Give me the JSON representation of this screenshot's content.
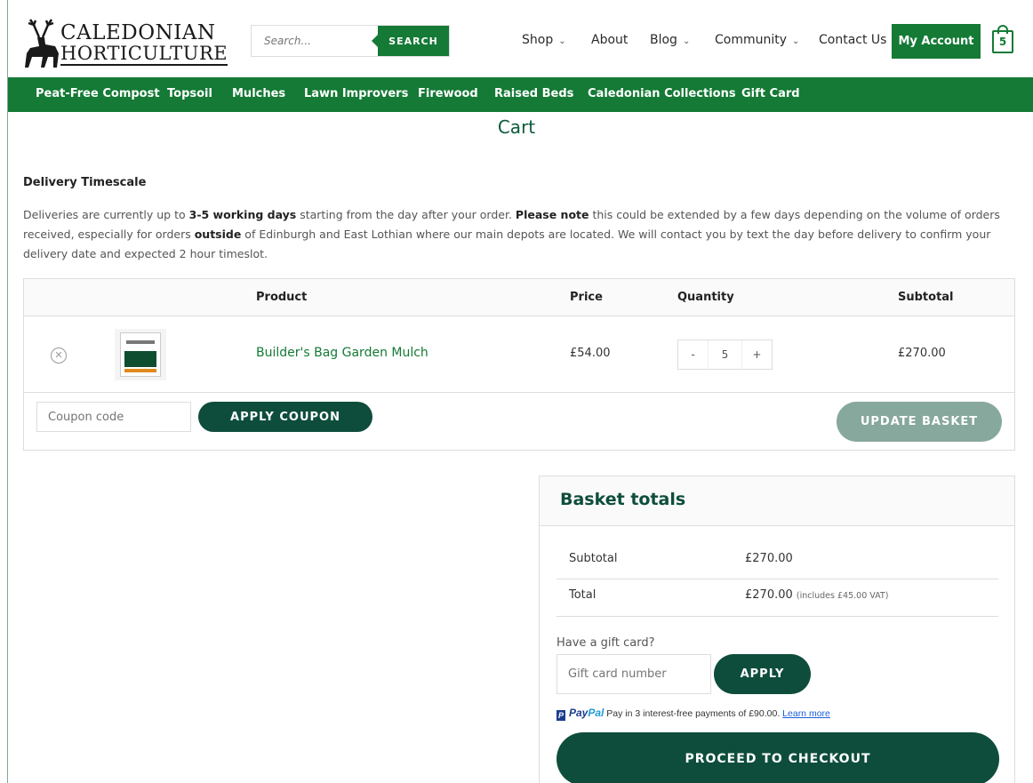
{
  "header": {
    "logo_line1": "CALEDONIAN",
    "logo_line2": "HORTICULTURE",
    "search_placeholder": "Search...",
    "search_button": "SEARCH",
    "nav": [
      {
        "label": "Shop"
      },
      {
        "label": "About"
      },
      {
        "label": "Blog"
      },
      {
        "label": "Community"
      },
      {
        "label": "Contact Us"
      }
    ],
    "my_account": "My Account",
    "cart_count": "5"
  },
  "categories": [
    "Peat-Free Compost",
    "Topsoil",
    "Mulches",
    "Lawn Improvers",
    "Firewood",
    "Raised Beds",
    "Caledonian Collections",
    "Gift Card"
  ],
  "page_title": "Cart",
  "delivery": {
    "title": "Delivery Timescale",
    "p1": "Deliveries are currently up to ",
    "b1": "3-5 working days",
    "p2": " starting from the day after your order. ",
    "b2": "Please note",
    "p3": " this could be extended by a few days depending on the volume of orders received, especially for orders ",
    "b3": "outside",
    "p4": " of Edinburgh and East Lothian where our main depots are located. We will contact you by text the day before delivery to confirm your delivery date and expected 2 hour timeslot."
  },
  "cart_table": {
    "headers": {
      "product": "Product",
      "price": "Price",
      "quantity": "Quantity",
      "subtotal": "Subtotal"
    },
    "items": [
      {
        "remove": "✕",
        "name": "Builder's Bag Garden Mulch",
        "price": "£54.00",
        "minus": "-",
        "qty": "5",
        "plus": "+",
        "subtotal": "£270.00"
      }
    ],
    "coupon_placeholder": "Coupon code",
    "apply_coupon": "APPLY COUPON",
    "update_basket": "UPDATE BASKET"
  },
  "totals": {
    "title": "Basket totals",
    "subtotal_label": "Subtotal",
    "subtotal_value": "£270.00",
    "total_label": "Total",
    "total_value": "£270.00",
    "total_note": "(includes £45.00 VAT)",
    "gift_label": "Have a gift card?",
    "gift_placeholder": "Gift card number",
    "gift_apply": "APPLY",
    "paypal_logo": "P",
    "paypal_pay": "Pay",
    "paypal_pal": "Pal",
    "paypal_text": "Pay in 3 interest-free payments of £90.00.",
    "paypal_link": "Learn more",
    "checkout": "PROCEED TO CHECKOUT"
  }
}
